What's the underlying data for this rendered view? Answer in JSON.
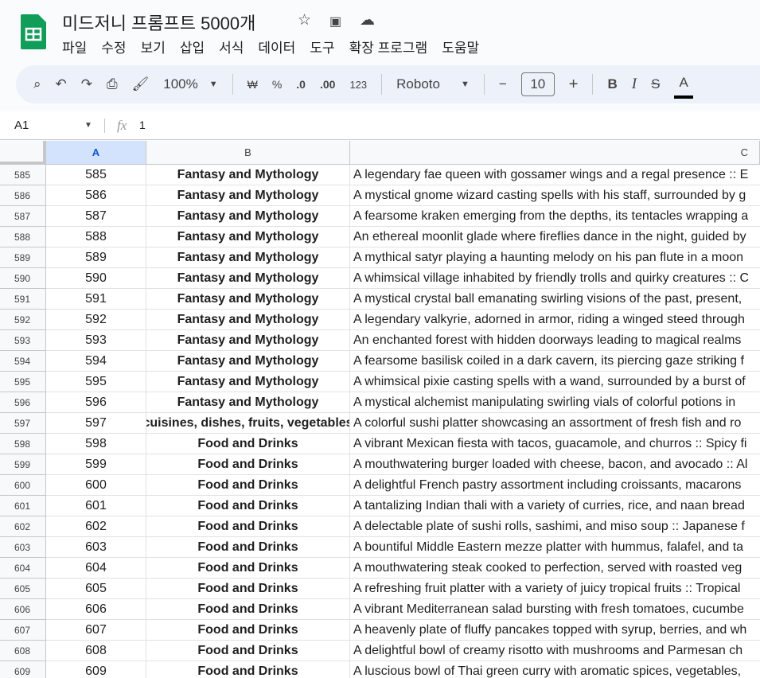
{
  "app": {
    "title": "미드저니 프롬프트 5000개",
    "brand_color": "#0f9d58"
  },
  "menu": [
    "파일",
    "수정",
    "보기",
    "삽입",
    "서식",
    "데이터",
    "도구",
    "확장 프로그램",
    "도움말"
  ],
  "toolbar": {
    "zoom": "100%",
    "currency": "₩",
    "percent": "%",
    "dec_decrease": ".0",
    "dec_increase": ".00",
    "format": "123",
    "font": "Roboto",
    "font_size": "10",
    "bold": "B",
    "italic": "I",
    "strike": "S",
    "text_color": "A"
  },
  "formula_bar": {
    "cell_ref": "A1",
    "fx": "fx",
    "value": "1"
  },
  "columns": [
    "A",
    "B",
    "C"
  ],
  "rows": [
    {
      "n": "585",
      "a": "585",
      "b": "Fantasy and Mythology",
      "c": "A legendary fae queen with gossamer wings and a regal presence :: E"
    },
    {
      "n": "586",
      "a": "586",
      "b": "Fantasy and Mythology",
      "c": "A mystical gnome wizard casting spells with his staff, surrounded by g"
    },
    {
      "n": "587",
      "a": "587",
      "b": "Fantasy and Mythology",
      "c": "A fearsome kraken emerging from the depths, its tentacles wrapping a"
    },
    {
      "n": "588",
      "a": "588",
      "b": "Fantasy and Mythology",
      "c": "An ethereal moonlit glade where fireflies dance in the night, guided by"
    },
    {
      "n": "589",
      "a": "589",
      "b": "Fantasy and Mythology",
      "c": "A mythical satyr playing a haunting melody on his pan flute in a moon"
    },
    {
      "n": "590",
      "a": "590",
      "b": "Fantasy and Mythology",
      "c": "A whimsical village inhabited by friendly trolls and quirky creatures :: C"
    },
    {
      "n": "591",
      "a": "591",
      "b": "Fantasy and Mythology",
      "c": "A mystical crystal ball emanating swirling visions of the past, present,"
    },
    {
      "n": "592",
      "a": "592",
      "b": "Fantasy and Mythology",
      "c": "A legendary valkyrie, adorned in armor, riding a winged steed through"
    },
    {
      "n": "593",
      "a": "593",
      "b": "Fantasy and Mythology",
      "c": "An enchanted forest with hidden doorways leading to magical realms"
    },
    {
      "n": "594",
      "a": "594",
      "b": "Fantasy and Mythology",
      "c": "A fearsome basilisk coiled in a dark cavern, its piercing gaze striking f"
    },
    {
      "n": "595",
      "a": "595",
      "b": "Fantasy and Mythology",
      "c": "A whimsical pixie casting spells with a wand, surrounded by a burst of"
    },
    {
      "n": "596",
      "a": "596",
      "b": "Fantasy and Mythology",
      "c": "A mystical alchemist manipulating swirling vials of colorful potions in"
    },
    {
      "n": "597",
      "a": "597",
      "b": "cuisines, dishes, fruits, vegetables",
      "c": "A colorful sushi platter showcasing an assortment of fresh fish and ro"
    },
    {
      "n": "598",
      "a": "598",
      "b": "Food and Drinks",
      "c": "A vibrant Mexican fiesta with tacos, guacamole, and churros :: Spicy fi"
    },
    {
      "n": "599",
      "a": "599",
      "b": "Food and Drinks",
      "c": "A mouthwatering burger loaded with cheese, bacon, and avocado :: Al"
    },
    {
      "n": "600",
      "a": "600",
      "b": "Food and Drinks",
      "c": "A delightful French pastry assortment including croissants, macarons"
    },
    {
      "n": "601",
      "a": "601",
      "b": "Food and Drinks",
      "c": "A tantalizing Indian thali with a variety of curries, rice, and naan bread"
    },
    {
      "n": "602",
      "a": "602",
      "b": "Food and Drinks",
      "c": "A delectable plate of sushi rolls, sashimi, and miso soup :: Japanese f"
    },
    {
      "n": "603",
      "a": "603",
      "b": "Food and Drinks",
      "c": "A bountiful Middle Eastern mezze platter with hummus, falafel, and ta"
    },
    {
      "n": "604",
      "a": "604",
      "b": "Food and Drinks",
      "c": "A mouthwatering steak cooked to perfection, served with roasted veg"
    },
    {
      "n": "605",
      "a": "605",
      "b": "Food and Drinks",
      "c": "A refreshing fruit platter with a variety of juicy tropical fruits :: Tropical"
    },
    {
      "n": "606",
      "a": "606",
      "b": "Food and Drinks",
      "c": "A vibrant Mediterranean salad bursting with fresh tomatoes, cucumbe"
    },
    {
      "n": "607",
      "a": "607",
      "b": "Food and Drinks",
      "c": "A heavenly plate of fluffy pancakes topped with syrup, berries, and wh"
    },
    {
      "n": "608",
      "a": "608",
      "b": "Food and Drinks",
      "c": "A delightful bowl of creamy risotto with mushrooms and Parmesan ch"
    },
    {
      "n": "609",
      "a": "609",
      "b": "Food and Drinks",
      "c": "A luscious bowl of Thai green curry with aromatic spices, vegetables,"
    }
  ]
}
